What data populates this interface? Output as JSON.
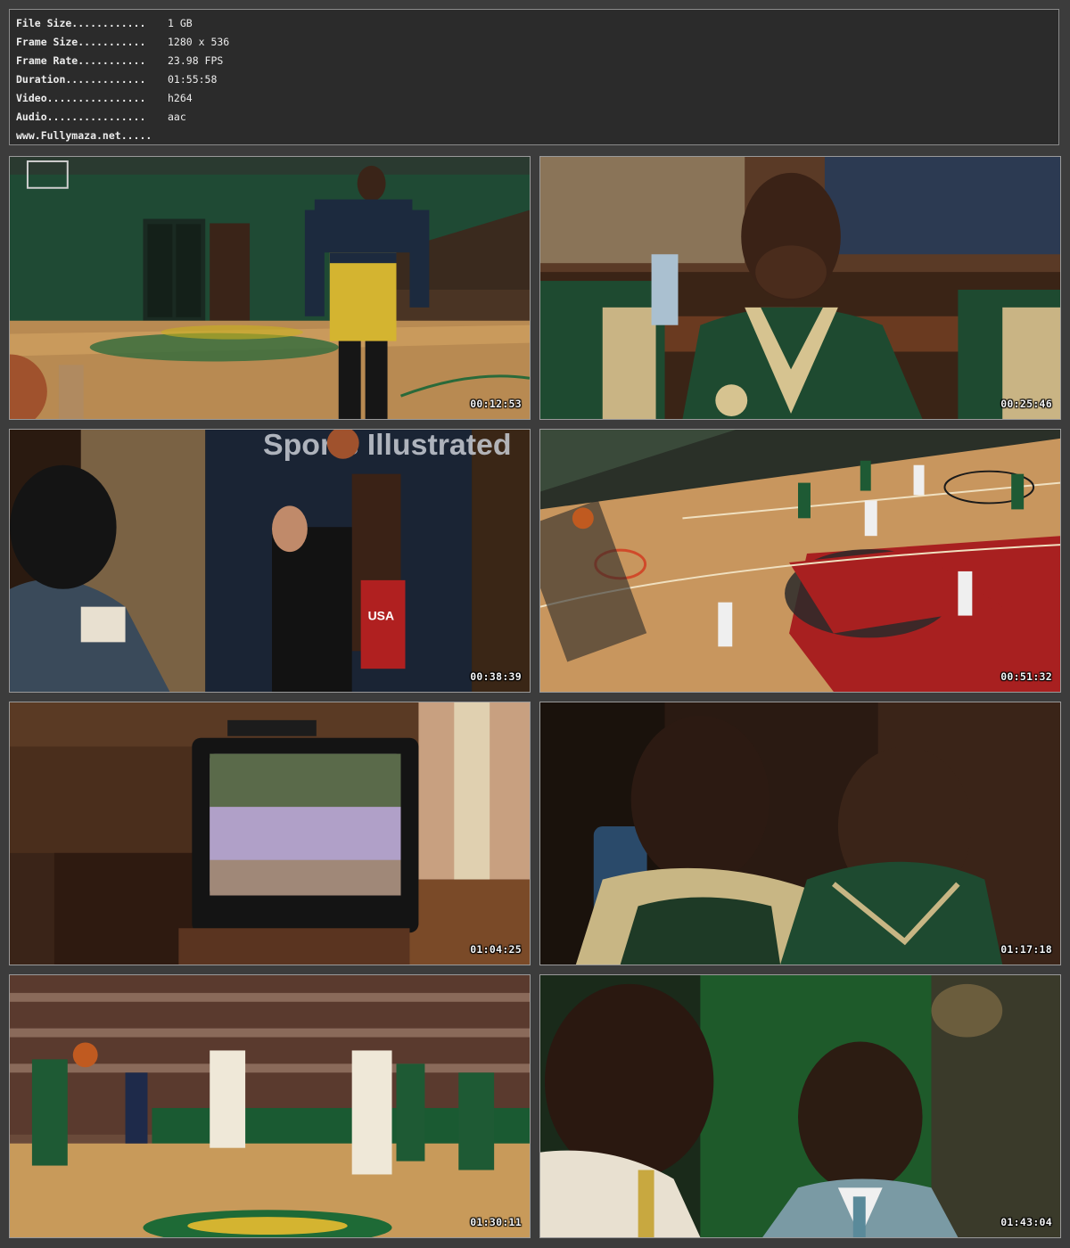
{
  "info": [
    {
      "label": "File Size............",
      "value": "1 GB"
    },
    {
      "label": "Frame Size...........",
      "value": "1280 x 536"
    },
    {
      "label": "Frame Rate...........",
      "value": "23.98 FPS"
    },
    {
      "label": "Duration.............",
      "value": "01:55:58"
    },
    {
      "label": "Video................",
      "value": "h264"
    },
    {
      "label": "Audio................",
      "value": "aac"
    },
    {
      "label": "www.Fullymaza.net.....",
      "value": ""
    }
  ],
  "thumbnails": [
    {
      "timestamp": "00:12:53",
      "scene": "gym-player-walking"
    },
    {
      "timestamp": "00:25:46",
      "scene": "bench-player-closeup"
    },
    {
      "timestamp": "00:38:39",
      "scene": "poster-room"
    },
    {
      "timestamp": "00:51:32",
      "scene": "court-aerial"
    },
    {
      "timestamp": "01:04:25",
      "scene": "tv-screen"
    },
    {
      "timestamp": "01:17:18",
      "scene": "two-players-dark"
    },
    {
      "timestamp": "01:30:11",
      "scene": "game-crowd"
    },
    {
      "timestamp": "01:43:04",
      "scene": "two-men-profile"
    }
  ],
  "poster_text": {
    "magazine": "Sports Illustrated",
    "jersey": "USA"
  },
  "colors": {
    "background": "#3c3c3c",
    "panel": "#2b2b2b",
    "text": "#ececec",
    "border": "#8a8a8a"
  }
}
